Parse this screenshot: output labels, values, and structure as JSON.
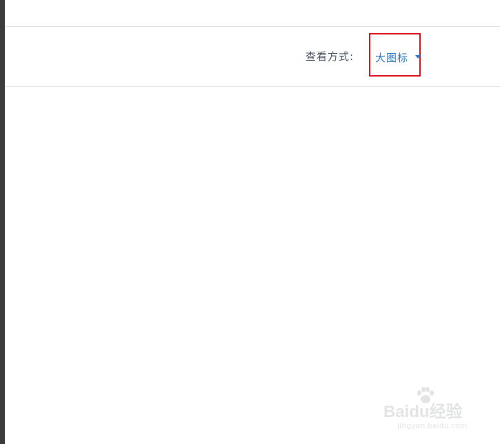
{
  "toolbar": {
    "view_label": "查看方式:",
    "view_value": "大图标",
    "caret_icon": "chevron-down-icon"
  },
  "colors": {
    "accent": "#2b79c9",
    "highlight_box": "#d9141c",
    "label": "#4d5563"
  },
  "watermark": {
    "text": "Baidu经验",
    "sub": "jingyan.baidu.com"
  }
}
